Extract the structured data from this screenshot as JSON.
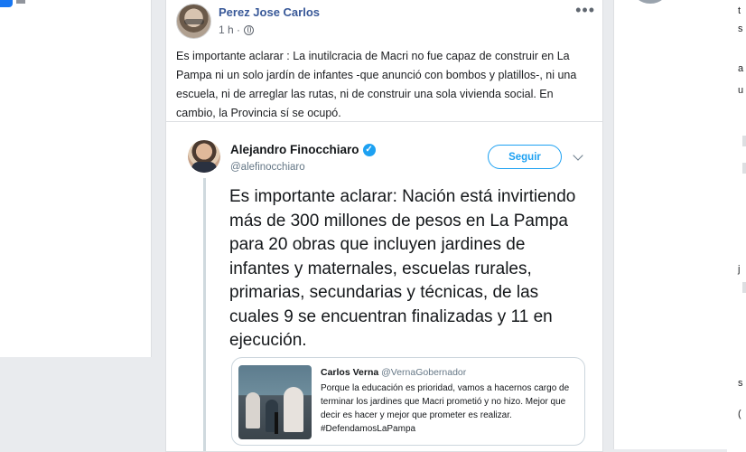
{
  "post": {
    "author": "Perez Jose Carlos",
    "timestamp": "1 h ·",
    "menu_label": "•••",
    "text": "Es importante aclarar : La inutilcracia de Macri no fue capaz de construir en La Pampa ni un solo jardín de infantes -que anunció con bombos y platillos-, ni una escuela, ni de arreglar las rutas, ni de construir una sola vivienda social. En cambio, la Provincia sí se ocupó."
  },
  "tweet": {
    "name": "Alejandro Finocchiaro",
    "verified_mark": "✓",
    "handle": "@alefinocchiaro",
    "follow_label": "Seguir",
    "text": "Es importante aclarar: Nación está invirtiendo más de 300 millones de pesos en La Pampa para 20 obras que incluyen jardines de infantes y maternales, escuelas rurales, primarias, secundarias y técnicas, de las cuales 9 se encuentran finalizadas y 11 en ejecución."
  },
  "quote": {
    "name": "Carlos Verna",
    "handle": "@VernaGobernador",
    "text": "Porque la educación es prioridad, vamos a hacernos cargo de terminar los jardines que Macri prometió y no hizo. Mejor que decir es hacer y mejor que prometer es realizar. #DefendamosLaPampa"
  },
  "right_strip": {
    "chars": [
      "t",
      "s",
      "a",
      "u",
      "j",
      "s",
      "("
    ]
  },
  "icons": {
    "globe": "globe-icon",
    "verified": "verified-badge-icon",
    "chevron": "chevron-down-icon"
  },
  "colors": {
    "link": "#385898",
    "twitter_blue": "#1da1f2",
    "page_bg": "#e9ebee"
  }
}
